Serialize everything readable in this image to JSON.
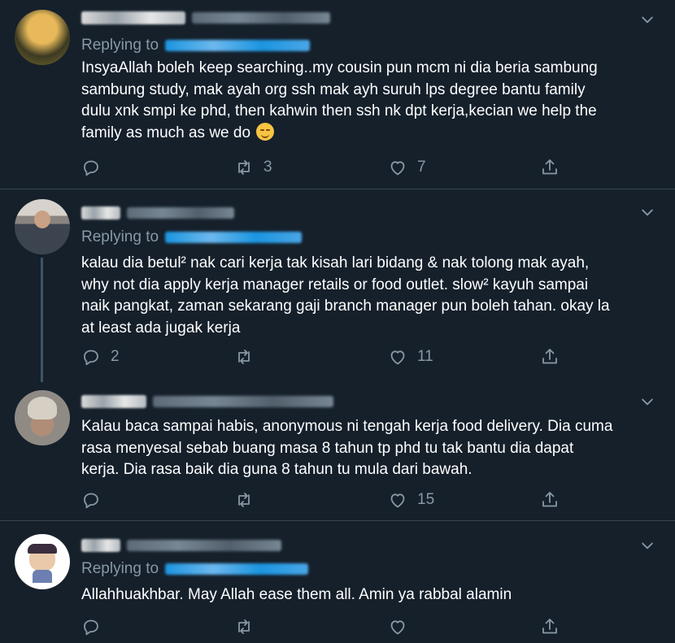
{
  "tweets": [
    {
      "replying_to_label": "Replying to",
      "text_lines": [
        "InsyaAllah boleh keep searching..my cousin pun mcm ni dia beria sambung",
        "sambung study, mak ayah org ssh mak ayh suruh lps degree bantu family",
        "dulu xnk smpi ke phd, then kahwin then ssh nk dpt kerja,kecian we help the",
        "family as much as we do"
      ],
      "emoji": "relieved-face-emoji",
      "reply_count": "",
      "retweet_count": "3",
      "like_count": "7"
    },
    {
      "replying_to_label": "Replying to",
      "text_lines": [
        "kalau dia betul² nak cari kerja tak kisah lari bidang & nak tolong mak ayah,",
        "why not dia apply kerja manager retails or food outlet. slow² kayuh sampai",
        "naik pangkat, zaman sekarang gaji branch manager pun boleh tahan. okay la",
        "at least ada jugak kerja"
      ],
      "reply_count": "2",
      "retweet_count": "",
      "like_count": "11"
    },
    {
      "text_lines": [
        "Kalau baca sampai habis, anonymous ni tengah kerja food delivery. Dia cuma",
        "rasa menyesal sebab buang masa 8 tahun tp phd tu tak bantu dia dapat",
        "kerja. Dia rasa baik dia guna 8 tahun tu mula dari bawah."
      ],
      "reply_count": "",
      "retweet_count": "",
      "like_count": "15"
    },
    {
      "replying_to_label": "Replying to",
      "text_lines": [
        "Allahhuakhbar. May Allah ease them all. Amin ya rabbal alamin"
      ],
      "reply_count": "",
      "retweet_count": "",
      "like_count": ""
    }
  ],
  "icons": {
    "reply": "reply-icon",
    "retweet": "retweet-icon",
    "like": "heart-icon",
    "share": "share-icon",
    "more": "chevron-down-icon"
  },
  "colors": {
    "background": "#15202b",
    "divider": "#38444d",
    "text": "#ffffff",
    "muted": "#8899a6",
    "link": "#1b95e0"
  }
}
